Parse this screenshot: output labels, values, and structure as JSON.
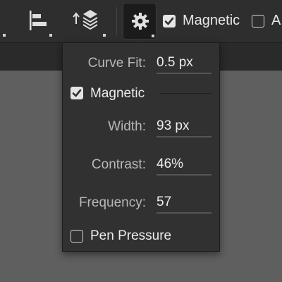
{
  "toolbar": {
    "magnetic_label": "Magnetic",
    "magnetic_checked": true,
    "next_label_partial": "A",
    "next_checked": false,
    "icons": [
      "align-left-icon",
      "arrange-layers-icon",
      "gear-icon"
    ]
  },
  "popover": {
    "curve_fit": {
      "label": "Curve Fit:",
      "value": "0.5 px"
    },
    "magnetic": {
      "label": "Magnetic",
      "checked": true
    },
    "width": {
      "label": "Width:",
      "value": "93 px"
    },
    "contrast": {
      "label": "Contrast:",
      "value": "46%"
    },
    "frequency": {
      "label": "Frequency:",
      "value": "57"
    },
    "pen_pressure": {
      "label": "Pen Pressure",
      "checked": false
    }
  },
  "colors": {
    "toolbar_bg": "#2e2e2e",
    "popover_bg": "#313131",
    "canvas_bg": "#5f5f5f",
    "text": "#e6e6e6"
  }
}
